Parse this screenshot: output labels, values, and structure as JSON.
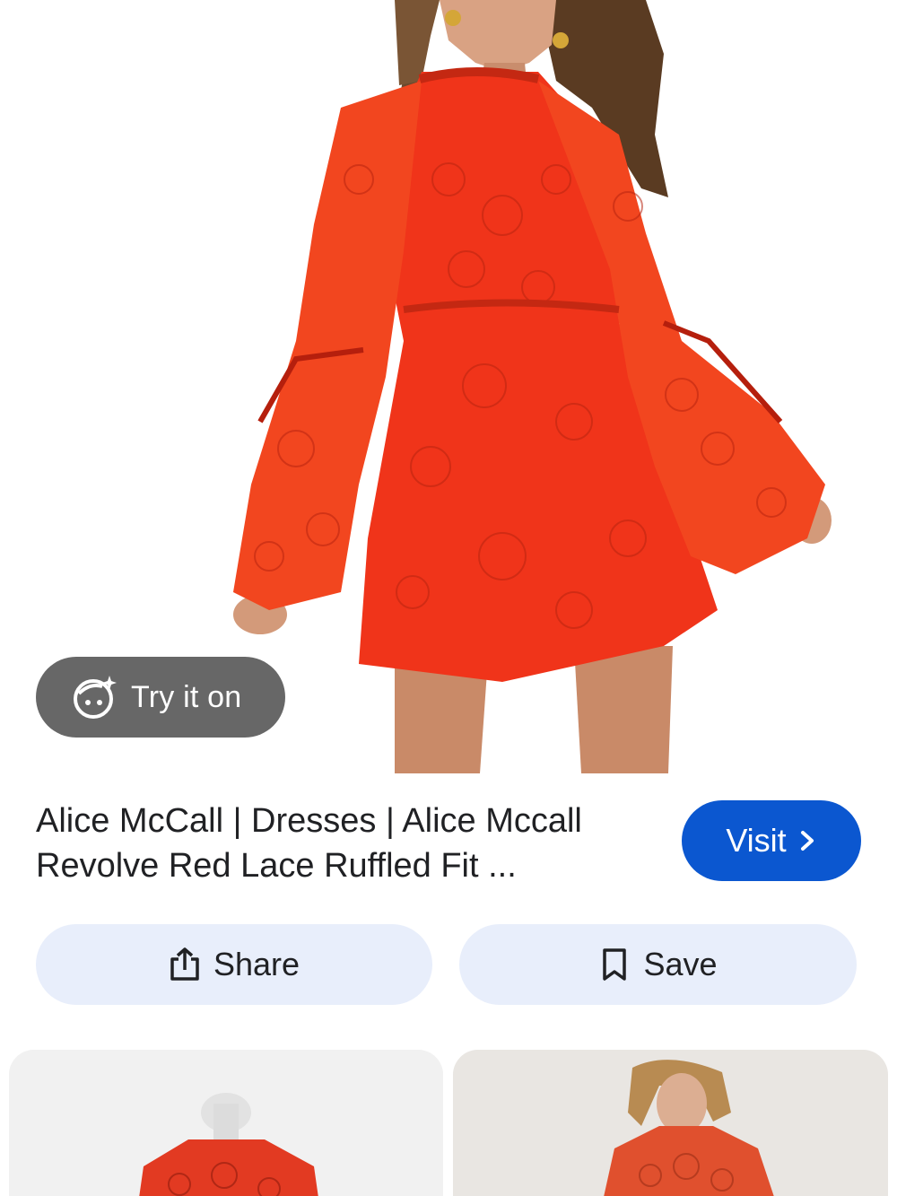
{
  "product": {
    "title_line1": "Alice McCall | Dresses | Alice Mccall",
    "title_line2": "Revolve Red Lace Ruffled Fit ...",
    "image_icon": "red-lace-dress-photo"
  },
  "actions": {
    "try_on_label": "Try it on",
    "try_on_icon": "face-sparkle-icon",
    "visit_label": "Visit",
    "visit_icon": "chevron-right-icon",
    "share_label": "Share",
    "share_icon": "share-icon",
    "save_label": "Save",
    "save_icon": "bookmark-icon"
  },
  "related": {
    "items": [
      {
        "icon": "red-lace-top-mannequin-thumbnail"
      },
      {
        "icon": "red-lace-dress-model-thumbnail"
      }
    ]
  },
  "colors": {
    "accent_blue": "#0b57d0",
    "pill_bg": "#e8eefb",
    "dress_red": "#f0341a"
  }
}
